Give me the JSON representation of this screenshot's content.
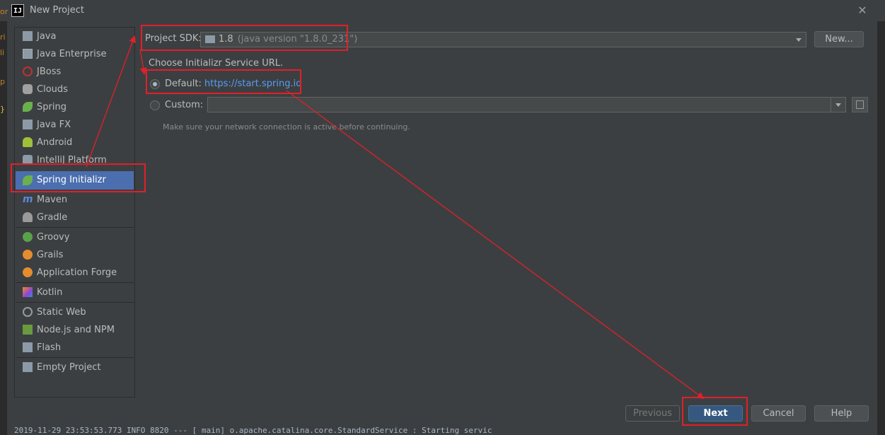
{
  "window": {
    "title": "New Project",
    "close_glyph": "✕",
    "app_icon_text": "IJ"
  },
  "sidebar": {
    "groups": [
      [
        {
          "label": "Java",
          "icon": "folder-icon"
        },
        {
          "label": "Java Enterprise",
          "icon": "java-enterprise-icon"
        },
        {
          "label": "JBoss",
          "icon": "jboss-icon"
        },
        {
          "label": "Clouds",
          "icon": "clouds-icon"
        },
        {
          "label": "Spring",
          "icon": "spring-leaf-icon"
        },
        {
          "label": "Java FX",
          "icon": "javafx-icon"
        },
        {
          "label": "Android",
          "icon": "android-icon"
        },
        {
          "label": "IntelliJ Platform Plugin",
          "icon": "plugin-icon"
        },
        {
          "label": "Spring Initializr",
          "icon": "spring-initializr-icon"
        },
        {
          "label": "Maven",
          "icon": "maven-icon"
        },
        {
          "label": "Gradle",
          "icon": "gradle-icon"
        }
      ],
      [
        {
          "label": "Groovy",
          "icon": "groovy-icon"
        },
        {
          "label": "Grails",
          "icon": "grails-icon"
        },
        {
          "label": "Application Forge",
          "icon": "application-forge-icon"
        }
      ],
      [
        {
          "label": "Kotlin",
          "icon": "kotlin-icon"
        }
      ],
      [
        {
          "label": "Static Web",
          "icon": "static-web-icon"
        },
        {
          "label": "Node.js and NPM",
          "icon": "nodejs-icon"
        },
        {
          "label": "Flash",
          "icon": "flash-icon"
        }
      ],
      [
        {
          "label": "Empty Project",
          "icon": "empty-project-icon"
        }
      ]
    ],
    "selected": "Spring Initializr"
  },
  "sdk": {
    "label": "Project SDK:",
    "value": "1.8",
    "detail": "(java version \"1.8.0_231\")",
    "new_button": "New..."
  },
  "service_url": {
    "heading": "Choose Initializr Service URL.",
    "default_label": "Default:",
    "default_url": "https://start.spring.io",
    "custom_label": "Custom:",
    "custom_value": "",
    "selected": "default",
    "note": "Make sure your network connection is active before continuing."
  },
  "footer": {
    "previous": "Previous",
    "next": "Next",
    "cancel": "Cancel",
    "help": "Help"
  },
  "background": {
    "console_line": "2019-11-29 23:53:53.773  INFO 8820 --- [           main] o.apache.catalina.core.StandardService   : Starting servic",
    "left_edge_chars": [
      "or",
      "ri",
      "li",
      "p",
      "}"
    ]
  },
  "colors": {
    "annotation_red": "#e0202a",
    "selection_blue": "#4b6eaf",
    "link_blue": "#589df6",
    "dialog_bg": "#3c3f41"
  }
}
